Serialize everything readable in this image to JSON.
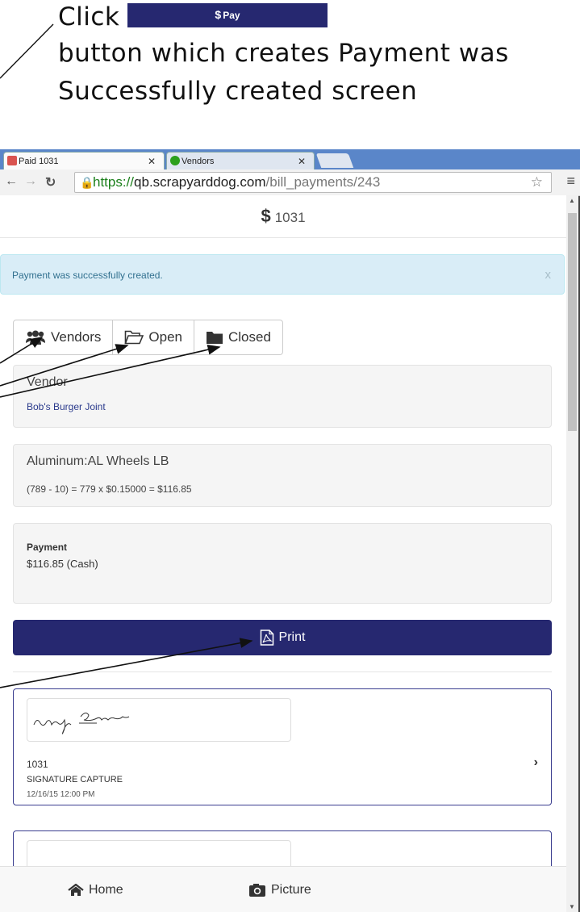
{
  "annotation": {
    "click_word": "Click",
    "line2": "button which creates Payment was",
    "line3": "Successfully created screen",
    "pay_sample_label": "Pay",
    "pay_sample_symbol": "$"
  },
  "browser": {
    "tabs": [
      {
        "label": "Paid 1031",
        "favicon": "dog-logo-icon",
        "favicon_color": "#d9534f"
      },
      {
        "label": "Vendors",
        "favicon": "qb-logo-icon",
        "favicon_color": "#2ca01c"
      }
    ],
    "url": {
      "scheme": "https://",
      "host": "qb.scrapyarddog.com",
      "path": "/bill_payments/243"
    }
  },
  "page": {
    "header_symbol": "$",
    "header_title": "1031",
    "alert_text": "Payment was successfully created.",
    "alert_close": "x",
    "tabs": [
      {
        "label": "Vendors",
        "icon": "users-icon"
      },
      {
        "label": "Open",
        "icon": "folder-open-icon"
      },
      {
        "label": "Closed",
        "icon": "folder-closed-icon"
      }
    ],
    "vendor": {
      "title": "Vendor",
      "name": "Bob's Burger Joint"
    },
    "line_item": {
      "title": "Aluminum:AL Wheels LB",
      "calc": "(789 - 10) = 779 x $0.15000 = $116.85"
    },
    "payment": {
      "label": "Payment",
      "value": "$116.85 (Cash)"
    },
    "print_label": "Print",
    "signature": {
      "number": "1031",
      "type": "SIGNATURE CAPTURE",
      "date": "12/16/15 12:00 PM"
    },
    "bottom_nav": {
      "home": "Home",
      "picture": "Picture"
    }
  },
  "colors": {
    "primary": "#262870",
    "alert_bg": "#d9edf7",
    "alert_text": "#31708f",
    "link": "#2a3a8c"
  }
}
